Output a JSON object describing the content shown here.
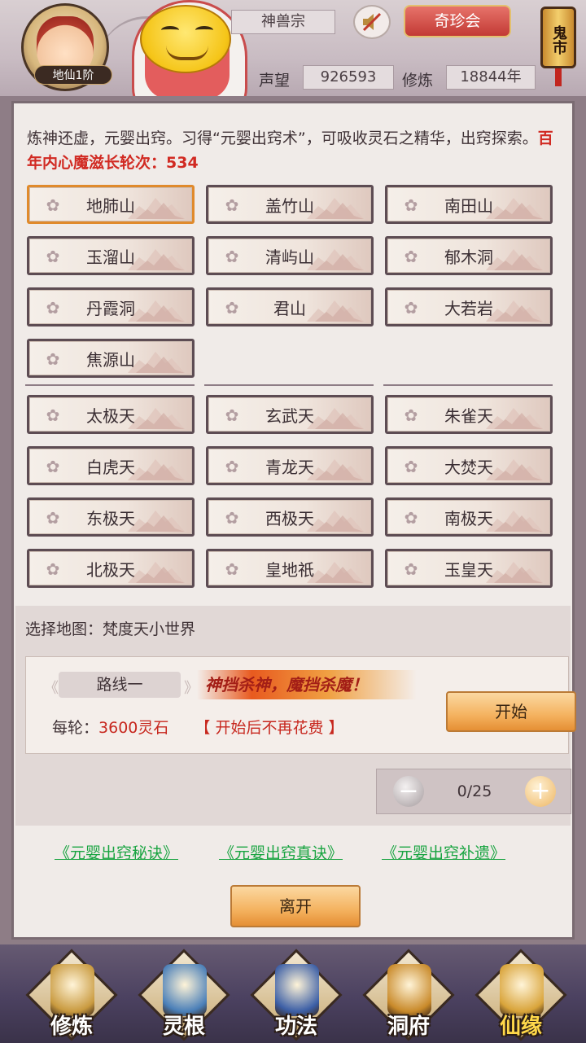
{
  "header": {
    "rank_badge": "地仙1阶",
    "sect_name": "神兽宗",
    "qizhen_button": "奇珍会",
    "guishi_label": "鬼市",
    "reputation_label": "声望",
    "reputation_value": "926593",
    "cultivation_label": "修炼",
    "cultivation_value": "18844年"
  },
  "intro": {
    "text": "炼神还虚，元婴出窍。习得“元婴出窍术”，可吸收灵石之精华，出窍探索。",
    "highlight": "百年内心魔滋长轮次：534"
  },
  "maps_group1": [
    {
      "label": "地肺山",
      "selected": true
    },
    {
      "label": "盖竹山",
      "selected": false
    },
    {
      "label": "南田山",
      "selected": false
    },
    {
      "label": "玉溜山",
      "selected": false
    },
    {
      "label": "清屿山",
      "selected": false
    },
    {
      "label": "郁木洞",
      "selected": false
    },
    {
      "label": "丹霞洞",
      "selected": false
    },
    {
      "label": "君山",
      "selected": false
    },
    {
      "label": "大若岩",
      "selected": false
    },
    {
      "label": "焦源山",
      "selected": false
    }
  ],
  "maps_group2": [
    {
      "label": "太极天"
    },
    {
      "label": "玄武天"
    },
    {
      "label": "朱雀天"
    },
    {
      "label": "白虎天"
    },
    {
      "label": "青龙天"
    },
    {
      "label": "大焚天"
    },
    {
      "label": "东极天"
    },
    {
      "label": "西极天"
    },
    {
      "label": "南极天"
    },
    {
      "label": "北极天"
    },
    {
      "label": "皇地祇"
    },
    {
      "label": "玉皇天"
    }
  ],
  "selection": {
    "choose_map_text": "选择地图：梵度天小世界",
    "route_label": "路线一",
    "slogan": "神挡杀神，魔挡杀魔！",
    "cost_prefix": "每轮：",
    "cost_value": "3600灵石",
    "cost_note": "【 开始后不再花费 】",
    "start_button": "开始",
    "stepper_value": "0/25"
  },
  "links": [
    "《元婴出窍秘诀》",
    "《元婴出窍真诀》",
    "《元婴出窍补遗》"
  ],
  "leave_button": "离开",
  "bottom_nav": [
    {
      "label": "修炼",
      "icon": "monk-icon",
      "active": false
    },
    {
      "label": "灵根",
      "icon": "sword-icon",
      "active": false
    },
    {
      "label": "功法",
      "icon": "book-icon",
      "active": false
    },
    {
      "label": "洞府",
      "icon": "pavilion-icon",
      "active": false
    },
    {
      "label": "仙缘",
      "icon": "gourd-icon",
      "active": true
    }
  ],
  "colors": {
    "accent_red": "#d12a22",
    "link_green": "#19a441",
    "selected_border": "#e08a2c",
    "active_nav": "#ffd84a"
  }
}
